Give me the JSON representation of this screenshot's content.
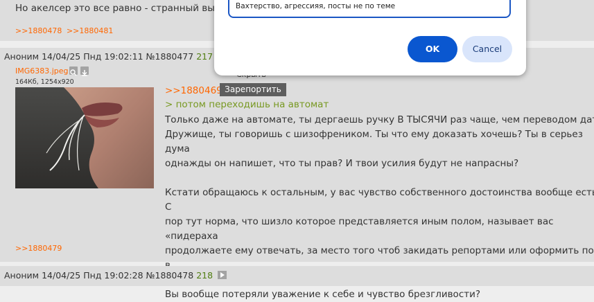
{
  "posts": {
    "top": {
      "text": "Но акелсер это все равно - странный выб",
      "reply_links": [
        ">>1880478",
        ">>1880481"
      ]
    },
    "main": {
      "author": "Аноним",
      "date": "14/04/25 Пнд 19:02:11",
      "number": "№1880477",
      "count": "217",
      "file_name": "IMG6383.jpeg",
      "file_meta": "164Кб, 1254x920",
      "reply_ref": ">>1880469",
      "greentext": "> потом переходишь на автомат",
      "body": "Только даже на автомате, ты дергаешь ручку В ТЫСЯЧИ раз чаще, чем переводом даты\nДружище, ты говоришь с шизофреником. Ты что ему доказать хочешь? Ты в серьез дума\nоднажды он напишет, что ты прав? И твои усилия будут не напрасны?\n\nКстати обращаюсь к остальным, у вас чувство собственного достоинства вообще есть? С\nпор тут норма, что шизло которое представляется иным полом, называет вас «пидераха\nпродолжаете ему отвечать, за место того чтоб закидать репортами или оформить пост в\nмодеров и забанить его к хуям?\nВы вообще потеряли уважение к себе и чувство брезгливости?",
      "reply_links": [
        ">>1880479"
      ]
    },
    "bottom": {
      "author": "Аноним",
      "date": "14/04/25 Пнд 19:02:28",
      "number": "№1880478",
      "count": "218"
    }
  },
  "context_menu": {
    "report_label": "Зарепортить",
    "hide_label": "Скрыть"
  },
  "report_dialog": {
    "reason_value": "Вахтерство, агрессияя, посты не по теме",
    "ok_label": "OK",
    "cancel_label": "Cancel"
  },
  "colors": {
    "link": "#ff6600",
    "greentext": "#789922",
    "post_bg": "#dddddd",
    "page_bg": "#eeeeee",
    "ok_button": "#0a57d0",
    "cancel_button": "#d9e5fb"
  },
  "icons": [
    "play-arrow-icon",
    "search-icon",
    "download-icon"
  ]
}
